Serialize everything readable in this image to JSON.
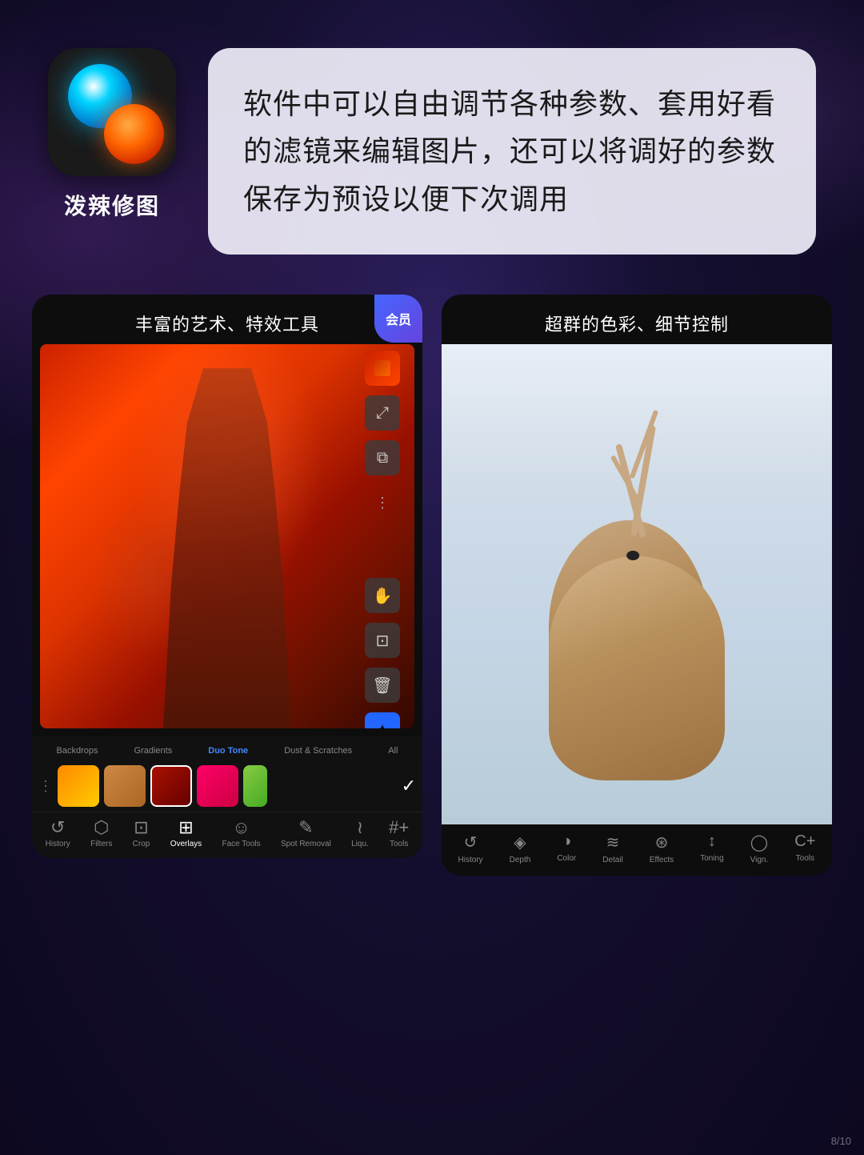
{
  "app": {
    "name": "泼辣修图",
    "icon": {
      "orb_blue": "blue-orb",
      "orb_orange": "orange-orb"
    }
  },
  "description": {
    "text": "软件中可以自由调节各种参数、套用好看的滤镜来编辑图片，还可以将调好的参数保存为预设以便下次调用"
  },
  "left_panel": {
    "title": "丰富的艺术、特效工具",
    "vip_label": "会员",
    "filter_tabs": [
      {
        "label": "Backdrops",
        "active": false
      },
      {
        "label": "Gradients",
        "active": false
      },
      {
        "label": "Duo Tone",
        "active": true
      },
      {
        "label": "Dust & Scratches",
        "active": false
      },
      {
        "label": "All",
        "active": false
      }
    ],
    "tools": [
      {
        "label": "History",
        "icon": "↺"
      },
      {
        "label": "Filters",
        "icon": "◈"
      },
      {
        "label": "Crop",
        "icon": "⊡"
      },
      {
        "label": "Overlays",
        "icon": "⊞"
      },
      {
        "label": "Face Tools",
        "icon": "☺"
      },
      {
        "label": "Spot Removal",
        "icon": "✎"
      },
      {
        "label": "Liqu.",
        "icon": "⌁"
      },
      {
        "label": "Tools",
        "icon": "#"
      }
    ]
  },
  "right_panel": {
    "title": "超群的色彩、细节控制",
    "tools": [
      {
        "label": "History",
        "icon": "↺"
      },
      {
        "label": "Depth",
        "icon": "◈"
      },
      {
        "label": "Color",
        "icon": "◑"
      },
      {
        "label": "Detail",
        "icon": "≋"
      },
      {
        "label": "Effects",
        "icon": "⊛"
      },
      {
        "label": "Toning",
        "icon": "↕"
      },
      {
        "label": "Vign.",
        "icon": "◯"
      },
      {
        "label": "Tools",
        "icon": "C+"
      }
    ]
  },
  "watermark": "8/10"
}
